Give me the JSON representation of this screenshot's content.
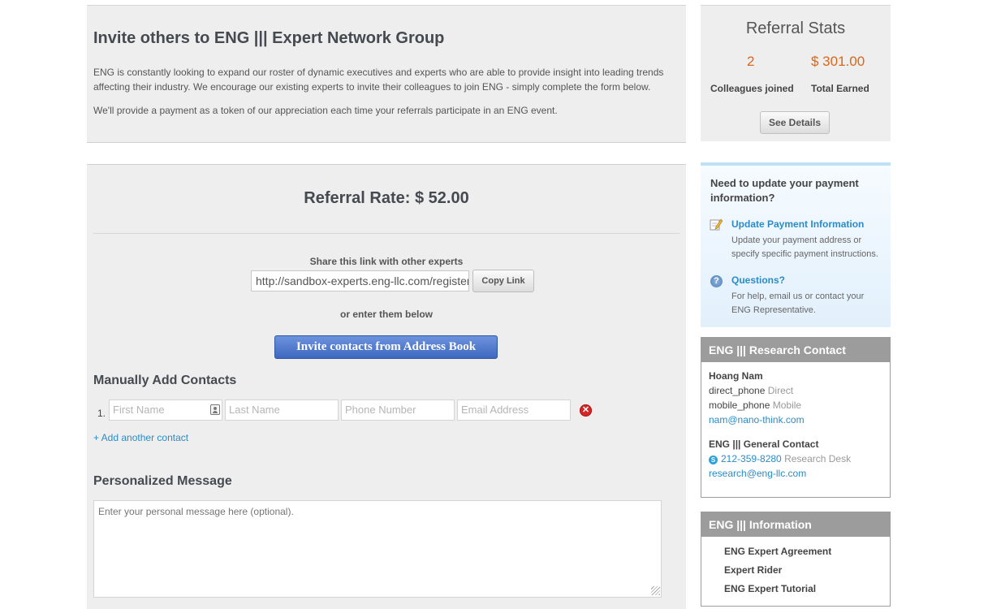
{
  "intro": {
    "title": "Invite others to ENG ||| Expert Network Group",
    "paragraph1": "ENG is constantly looking to expand our roster of dynamic executives and experts who are able to provide insight into leading trends affecting their industry. We encourage our existing experts to invite their colleagues to join ENG - simply complete the form below.",
    "paragraph2": "We'll provide a payment as a token of our appreciation each time your referrals participate in an ENG event."
  },
  "form": {
    "referral_rate": "Referral Rate: $ 52.00",
    "share_label": "Share this link with other experts",
    "share_link_value": "http://sandbox-experts.eng-llc.com/register",
    "copy_button": "Copy Link",
    "or_label": "or enter them below",
    "invite_button": "Invite contacts from Address Book",
    "manual_heading": "Manually Add Contacts",
    "row_number": "1.",
    "first_name_placeholder": "First Name",
    "last_name_placeholder": "Last Name",
    "phone_placeholder": "Phone Number",
    "email_placeholder": "Email Address",
    "remove_icon": "remove-icon",
    "add_contact": "+ Add another contact",
    "message_heading": "Personalized Message",
    "message_placeholder": "Enter your personal message here (optional)."
  },
  "stats": {
    "title": "Referral Stats",
    "colleagues_value": "2",
    "colleagues_label": "Colleagues joined",
    "earned_value": "$ 301.00",
    "earned_label": "Total Earned",
    "details_button": "See Details",
    "accent_color": "#d9661a"
  },
  "payment": {
    "question": "Need to update your payment information?",
    "update_link": "Update Payment Information",
    "update_desc": "Update your payment address or specify specific payment instructions.",
    "questions_link": "Questions?",
    "questions_desc": "For help, email us or contact your ENG Representative."
  },
  "research_contact": {
    "header": "ENG ||| Research Contact",
    "name": "Hoang Nam",
    "direct_value": "direct_phone",
    "direct_label": "Direct",
    "mobile_value": "mobile_phone",
    "mobile_label": "Mobile",
    "email": "nam@nano-think.com",
    "general_heading": "ENG ||| General Contact",
    "general_phone": "212-359-8280",
    "general_phone_label": "Research Desk",
    "general_email": "research@eng-llc.com"
  },
  "information": {
    "header": "ENG ||| Information",
    "items": [
      "ENG Expert Agreement",
      "Expert Rider",
      "ENG Expert Tutorial"
    ]
  }
}
